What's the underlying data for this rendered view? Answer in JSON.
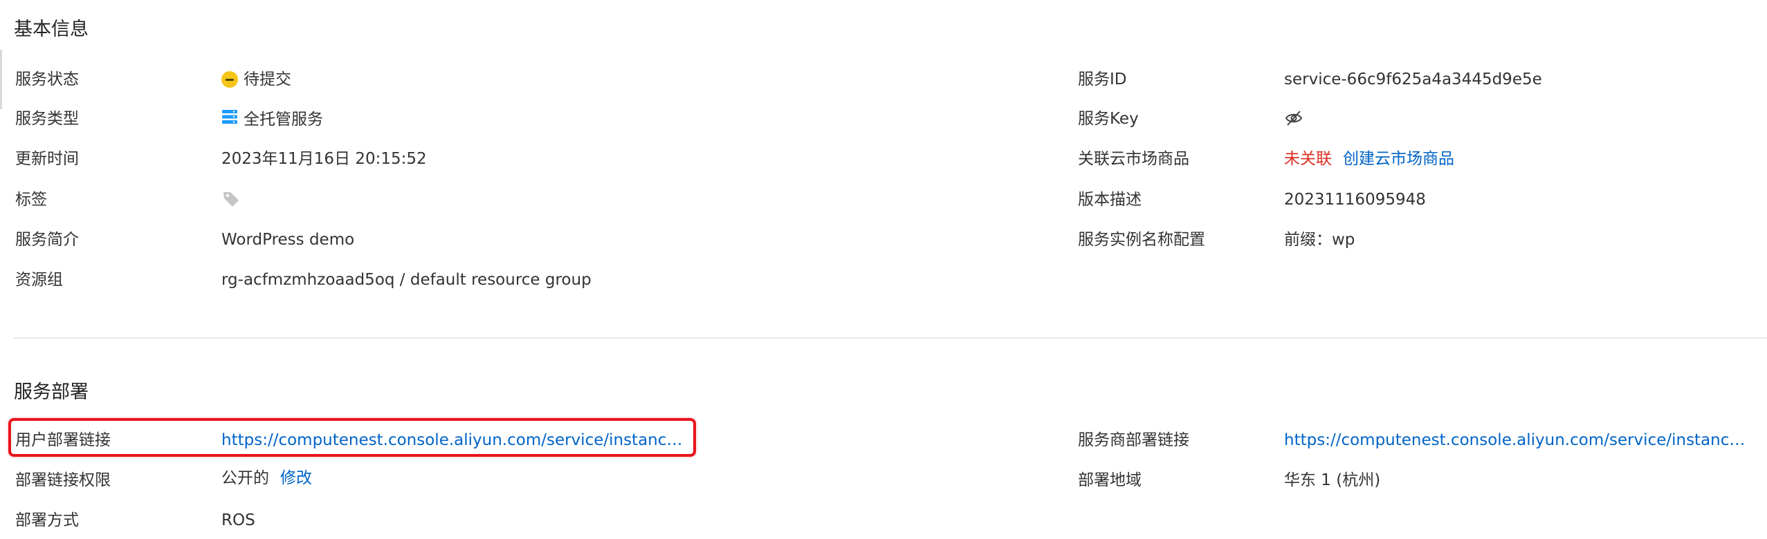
{
  "basic_info": {
    "title": "基本信息",
    "left": [
      {
        "label": "服务状态",
        "value": "待提交"
      },
      {
        "label": "服务类型",
        "value": "全托管服务"
      },
      {
        "label": "更新时间",
        "value": "2023年11月16日 20:15:52"
      },
      {
        "label": "标签",
        "value": ""
      },
      {
        "label": "服务简介",
        "value": "WordPress demo"
      },
      {
        "label": "资源组",
        "value": "rg-acfmzmhzoaad5oq / default resource group"
      }
    ],
    "right": [
      {
        "label": "服务ID",
        "value": "service-66c9f625a4a3445d9e5e"
      },
      {
        "label": "服务Key",
        "value": ""
      },
      {
        "label": "关联云市场商品",
        "value": "未关联",
        "action": "创建云市场商品"
      },
      {
        "label": "版本描述",
        "value": "20231116095948"
      },
      {
        "label": "服务实例名称配置",
        "value": "前缀：wp"
      }
    ]
  },
  "deploy": {
    "title": "服务部署",
    "left": [
      {
        "label": "用户部署链接",
        "value": "https://computenest.console.aliyun.com/service/instance/..."
      },
      {
        "label": "部署链接权限",
        "value": "公开的",
        "action": "修改"
      },
      {
        "label": "部署方式",
        "value": "ROS"
      }
    ],
    "right": [
      {
        "label": "服务商部署链接",
        "value": "https://computenest.console.aliyun.com/service/instance/..."
      },
      {
        "label": "部署地域",
        "value": "华东 1 (杭州)"
      }
    ]
  },
  "icons": {
    "status": "pending-status-icon",
    "service_type": "managed-service-icon",
    "tag": "tag-icon",
    "key": "eye-slash-icon"
  },
  "colors": {
    "link": "#0064c8",
    "unlinked": "#d93026",
    "status_pending": "#f5c518",
    "highlight_box": "#e8141b"
  }
}
